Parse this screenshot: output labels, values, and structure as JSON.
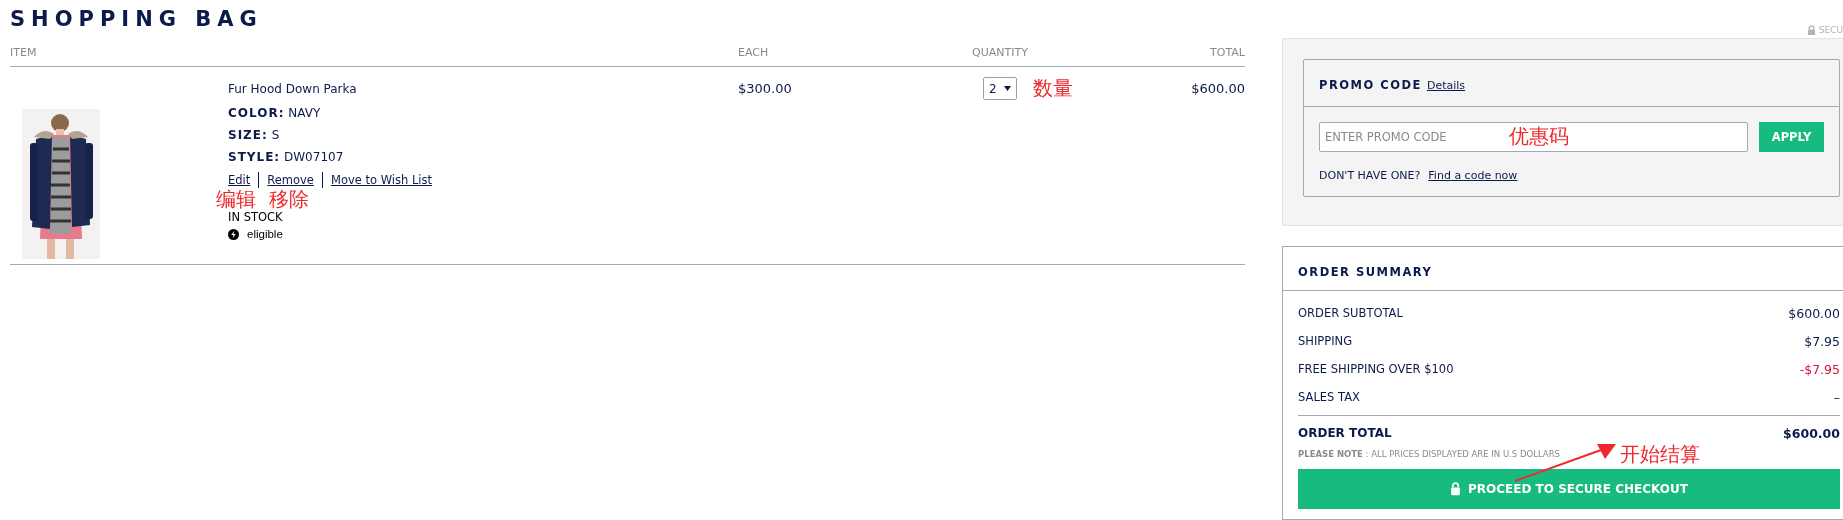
{
  "title": "SHOPPING BAG",
  "columns": [
    "ITEM",
    "EACH",
    "QUANTITY",
    "TOTAL"
  ],
  "items": [
    {
      "kind": "picture",
      "name": "Fur Hood Down Parka",
      "attributes": [
        {
          "label": "COLOR:",
          "value": "NAVY"
        },
        {
          "label": "SIZE:",
          "value": "S"
        },
        {
          "label": "STYLE:",
          "value": "DW07107"
        }
      ],
      "actions": [
        "Edit",
        "Remove",
        "Move to Wish List"
      ],
      "stock": "IN STOCK",
      "eligible": "eligible",
      "each": "$300.00",
      "quantity": "2",
      "total": "$600.00"
    }
  ],
  "secure": "SECU",
  "promo": {
    "title": "PROMO CODE",
    "details_link": "Details",
    "placeholder": "ENTER PROMO CODE",
    "apply": "APPLY",
    "prompt": "DON'T HAVE ONE?",
    "find_link": "Find a code now"
  },
  "summary": {
    "title": "ORDER SUMMARY",
    "lines": [
      {
        "label": "ORDER SUBTOTAL",
        "value": "$600.00",
        "kind": "charge"
      },
      {
        "label": "SHIPPING",
        "value": "$7.95",
        "kind": "charge"
      },
      {
        "label": "FREE SHIPPING OVER $100",
        "value": "-$7.95",
        "kind": "discount"
      },
      {
        "label": "SALES TAX",
        "value": "–",
        "kind": "charge"
      }
    ],
    "total_label": "ORDER TOTAL",
    "total": "$600.00",
    "note": "**PLEASE NOTE** : ALL PRICES DISPLAYED ARE IN U.S DOLLARS",
    "checkout": "PROCEED TO SECURE CHECKOUT"
  },
  "annotations": {
    "quantity": "数量",
    "actions": "编辑  移除",
    "promo": "优惠码",
    "checkout": "开始结算"
  }
}
